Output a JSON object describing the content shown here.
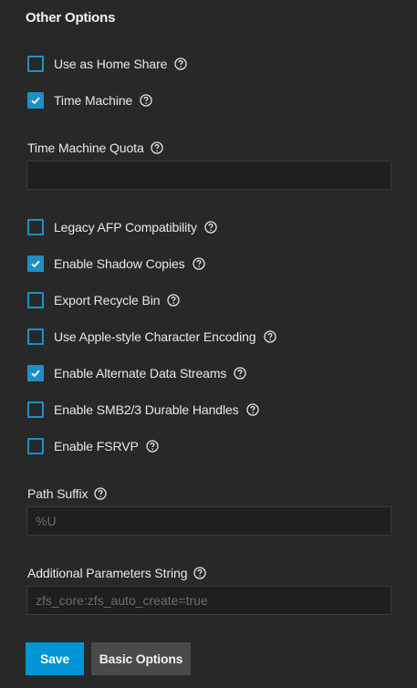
{
  "section": {
    "title": "Other Options"
  },
  "options": {
    "home_share": {
      "label": "Use as Home Share",
      "checked": false
    },
    "time_machine": {
      "label": "Time Machine",
      "checked": true
    },
    "legacy_afp": {
      "label": "Legacy AFP Compatibility",
      "checked": false
    },
    "shadow_copies": {
      "label": "Enable Shadow Copies",
      "checked": true
    },
    "recycle_bin": {
      "label": "Export Recycle Bin",
      "checked": false
    },
    "apple_encoding": {
      "label": "Use Apple-style Character Encoding",
      "checked": false
    },
    "alt_streams": {
      "label": "Enable Alternate Data Streams",
      "checked": true
    },
    "durable_handles": {
      "label": "Enable SMB2/3 Durable Handles",
      "checked": false
    },
    "fsrvp": {
      "label": "Enable FSRVP",
      "checked": false
    }
  },
  "fields": {
    "tm_quota": {
      "label": "Time Machine Quota",
      "value": "",
      "placeholder": ""
    },
    "path_suffix": {
      "label": "Path Suffix",
      "value": "",
      "placeholder": "%U"
    },
    "aux_params": {
      "label": "Additional Parameters String",
      "value": "",
      "placeholder": "zfs_core:zfs_auto_create=true"
    }
  },
  "buttons": {
    "save": "Save",
    "basic_options": "Basic Options"
  },
  "colors": {
    "accent": "#0095d5",
    "checkbox": "#1e8fc6",
    "background": "#282828",
    "input_bg": "#1f1f1f"
  },
  "icons": {
    "help": "help-circle-icon",
    "check": "checkmark-icon"
  }
}
